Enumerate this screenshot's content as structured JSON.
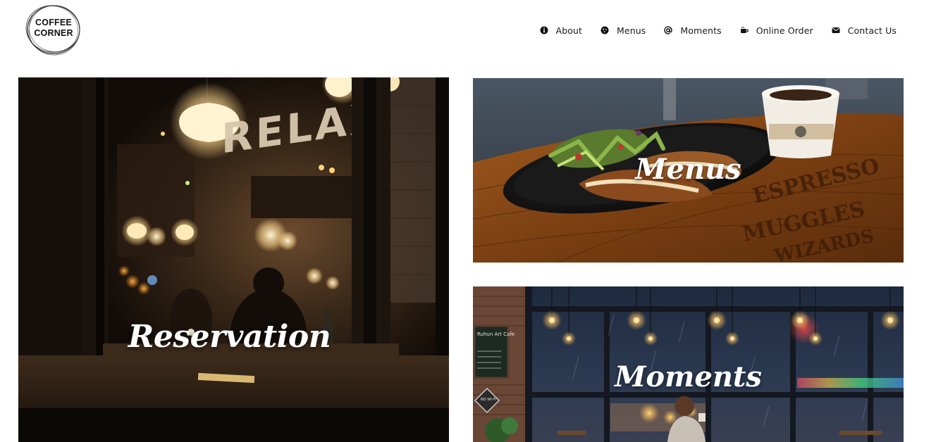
{
  "logo": {
    "line1": "COFFEE",
    "line2": "CORNER"
  },
  "nav": {
    "items": [
      {
        "label": "About",
        "icon": "info-icon"
      },
      {
        "label": "Menus",
        "icon": "cookie-icon"
      },
      {
        "label": "Moments",
        "icon": "at-icon"
      },
      {
        "label": "Online Order",
        "icon": "coffee-cup-icon"
      },
      {
        "label": "Contact Us",
        "icon": "envelope-icon"
      }
    ]
  },
  "tiles": {
    "reservation": {
      "title": "Reservation",
      "sign_text": "RELAX"
    },
    "menus": {
      "title": "Menus",
      "table_text_1": "ESPRESSO",
      "table_text_2": "MUGGLES",
      "table_text_3": "WIZARDS"
    },
    "moments": {
      "title": "Moments",
      "board_text": "Ruhun Art Cafe",
      "sign_text": "NO WI-FI"
    }
  },
  "colors": {
    "text": "#1a1a1a",
    "tile_title": "#ffffff",
    "background": "#ffffff"
  }
}
